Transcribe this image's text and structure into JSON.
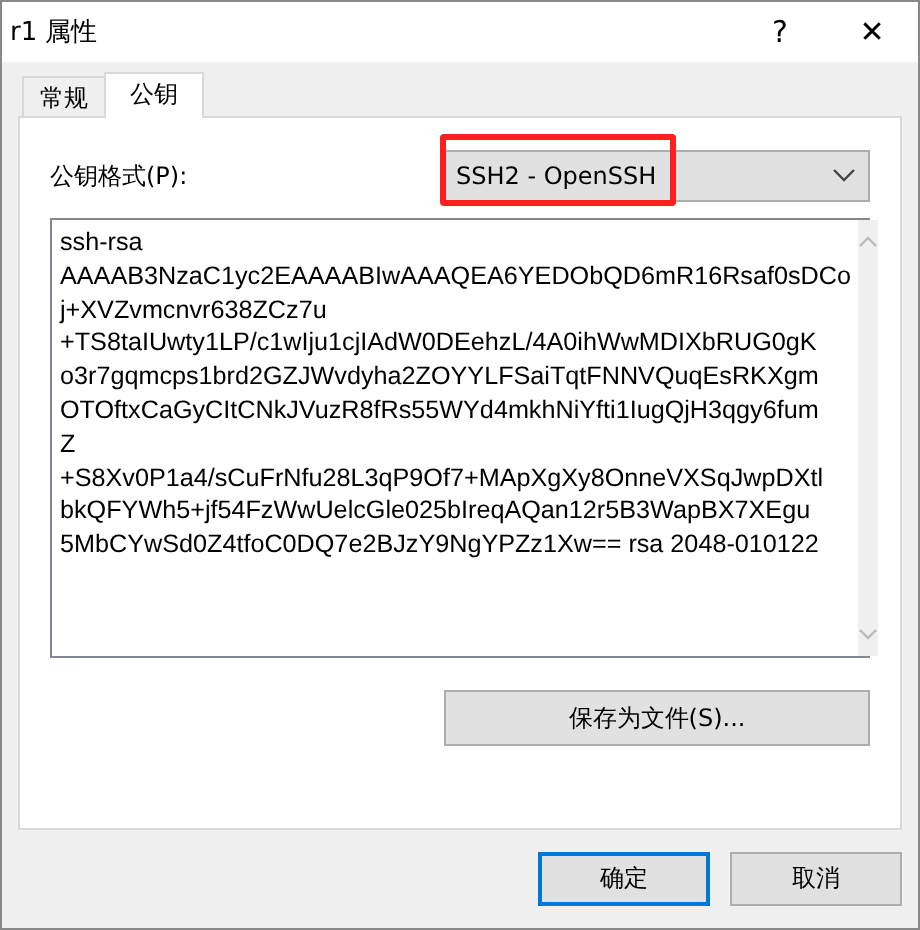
{
  "window": {
    "title": "r1 属性",
    "help": "?",
    "close": "✕"
  },
  "tabs": [
    {
      "label": "常规",
      "selected": false
    },
    {
      "label": "公钥",
      "selected": true
    }
  ],
  "format": {
    "label": "公钥格式(P):",
    "value": "SSH2 - OpenSSH",
    "highlighted": true
  },
  "key_text": [
    "ssh-rsa",
    "AAAAB3NzaC1yc2EAAAABIwAAAQEA6YEDObQD6mR16Rsaf0sDCo",
    "j+XVZvmcnvr638ZCz7u",
    "+TS8taIUwty1LP/c1wIju1cjIAdW0DEehzL/4A0ihWwMDIXbRUG0gK",
    "o3r7gqmcps1brd2GZJWvdyha2ZOYYLFSaiTqtFNNVQuqEsRKXgm",
    "OTOftxCaGyCItCNkJVuzR8fRs55WYd4mkhNiYfti1IugQjH3qgy6fum",
    "Z",
    "+S8Xv0P1a4/sCuFrNfu28L3qP9Of7+MApXgXy8OnneVXSqJwpDXtl",
    "bkQFYWh5+jf54FzWwUelcGle025bIreqAQan12r5B3WapBX7XEgu",
    "5MbCYwSd0Z4tfoC0DQ7e2BJzY9NgYPZz1Xw== rsa 2048-010122"
  ],
  "save_button": "保存为文件(S)...",
  "buttons": [
    {
      "label": "确定",
      "default": true
    },
    {
      "label": "取消",
      "default": false
    }
  ]
}
